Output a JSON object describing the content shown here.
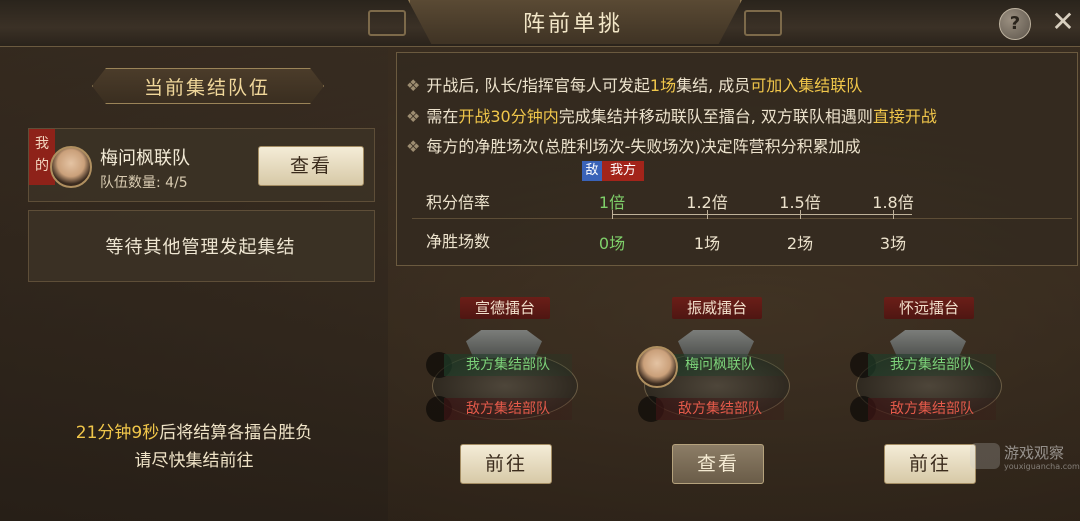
{
  "title": "阵前单挑",
  "header_buttons": {
    "help": "?",
    "close": "✕"
  },
  "left": {
    "header": "当前集结队伍",
    "team": {
      "tag": "我的",
      "name": "梅问枫联队",
      "count_label": "队伍数量: 4/5",
      "view_button": "查看"
    },
    "waiting": "等待其他管理发起集结",
    "countdown": {
      "time": "21分钟9秒",
      "suffix": "后将结算各擂台胜负",
      "line2": "请尽快集结前往"
    }
  },
  "rules": [
    {
      "pre": "开战后, 队长/指挥官每人可发起",
      "hl1": "1场",
      "mid": "集结, 成员",
      "hl2": "可加入集结联队",
      "post": ""
    },
    {
      "pre": "需在",
      "hl1": "开战30分钟内",
      "mid": "完成集结并移动联队至擂台, 双方联队相遇则",
      "hl2": "直接开战",
      "post": ""
    },
    {
      "pre": "每方的净胜场次(总胜利场次-失败场次)决定阵营积分积累加成",
      "hl1": "",
      "mid": "",
      "hl2": "",
      "post": ""
    }
  ],
  "score_table": {
    "tag_enemy": "敌",
    "tag_mine": "我方",
    "row1_label": "积分倍率",
    "row2_label": "净胜场数",
    "multipliers": [
      "1倍",
      "1.2倍",
      "1.5倍",
      "1.8倍"
    ],
    "net_wins": [
      "0场",
      "1场",
      "2场",
      "3场"
    ]
  },
  "arenas": [
    {
      "name": "宣德擂台",
      "ally": "我方集结部队",
      "enemy": "敌方集结部队",
      "button": "前往"
    },
    {
      "name": "振威擂台",
      "ally": "梅问枫联队",
      "enemy": "敌方集结部队",
      "button": "查看"
    },
    {
      "name": "怀远擂台",
      "ally": "我方集结部队",
      "enemy": "敌方集结部队",
      "button": "前往"
    }
  ],
  "watermark": {
    "text": "游戏观察",
    "sub": "youxiguancha.com"
  },
  "colors": {
    "highlight": "#f0c64a",
    "ally_green": "#7dd37a",
    "enemy_red": "#e45a4a",
    "tag_red": "#a3241a",
    "tag_blue": "#3a63b8"
  }
}
